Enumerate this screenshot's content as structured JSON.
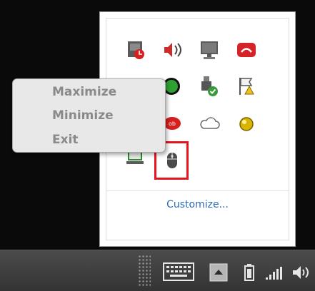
{
  "context_menu": {
    "items": [
      {
        "label": "Maximize"
      },
      {
        "label": "Minimize"
      },
      {
        "label": "Exit"
      }
    ]
  },
  "tray_flyout": {
    "customize_label": "Customize...",
    "icons": [
      "network-monitor-icon",
      "volume-icon",
      "display-icon",
      "red-app-icon",
      "green-app-icon",
      "remove-hardware-icon",
      "action-center-flag-icon",
      "red-app-2-icon",
      "cloud-icon",
      "yellow-ball-icon",
      "network-adapter-icon",
      "mouse-icon"
    ]
  },
  "taskbar": {
    "icons": [
      "touch-keyboard-icon",
      "show-hidden-icons-arrow",
      "battery-icon",
      "signal-bars-icon",
      "speaker-icon"
    ]
  },
  "colors": {
    "highlight": "#e4161b",
    "link": "#2a6bb5",
    "menu_text": "#8a8a8a",
    "taskbar": "#3d3d3d"
  }
}
